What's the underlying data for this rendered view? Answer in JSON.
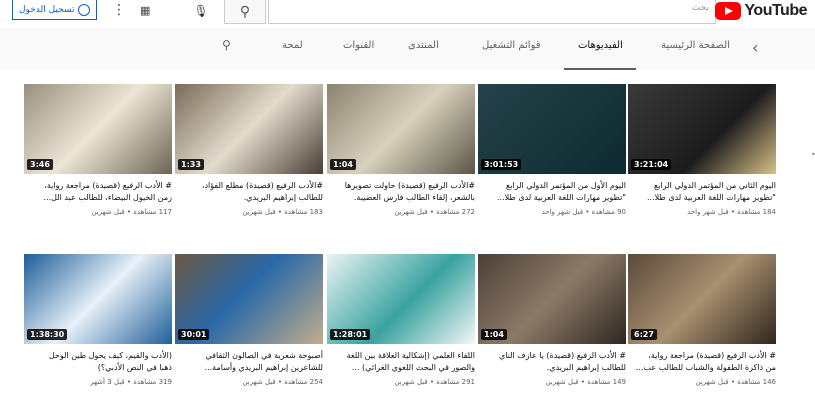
{
  "header": {
    "logo_text": "YouTube",
    "search_placeholder": "بحث",
    "signin_label": "تسجيل الدخول"
  },
  "tabs": {
    "items": [
      {
        "label": "الصفحة الرئيسية"
      },
      {
        "label": "الفيديوهات"
      },
      {
        "label": "قوائم التشغيل"
      },
      {
        "label": "المنتدى"
      },
      {
        "label": "القنوات"
      },
      {
        "label": "لمحة"
      }
    ],
    "active_index": 1
  },
  "videos": [
    {
      "title_line1": "اليوم الثاني من المؤتمر الدولي الرابع",
      "title_line2": "\"تطوير مهارات اللغة العربية لدى طلا...",
      "meta": "184 مشاهدة • قبل شهر واحد",
      "duration": "3:21:04",
      "thumb": "t1"
    },
    {
      "title_line1": "اليوم الأول من المؤتمر الدولي الرابع",
      "title_line2": "\"تطوير مهارات اللغة العربية لدى طلا...",
      "meta": "90 مشاهدة • قبل شهر واحد",
      "duration": "3:01:53",
      "thumb": "t2"
    },
    {
      "title_line1": "#الأدب الرفيع (قصيدة) حاولت تصويرها",
      "title_line2": "بالشعر، إلقاء الطالب فارس العضيبة.",
      "meta": "272 مشاهدة • قبل شهرين",
      "duration": "1:04",
      "thumb": "t3"
    },
    {
      "title_line1": "#الأدب الرفيع (قصيدة) مطلع الفؤاد،",
      "title_line2": "للطالب إبراهيم البريدي.",
      "meta": "183 مشاهدة • قبل شهرين",
      "duration": "1:33",
      "thumb": "t4"
    },
    {
      "title_line1": "# الأدب الرفيع (قصيدة) مراجعة رواية،",
      "title_line2": "زمن الخيول البيضاء، للطالب عبد الل...",
      "meta": "117 مشاهدة • قبل شهرين",
      "duration": "3:46",
      "thumb": "t5"
    },
    {
      "title_line1": "# الأدب الرفيع (قصيدة) مراجعة رواية،",
      "title_line2": "من ذاكرة الطفولة والشباب للطالب عب...",
      "meta": "146 مشاهدة • قبل شهرين",
      "duration": "6:27",
      "thumb": "t6"
    },
    {
      "title_line1": "# الأدب الرفيع (قصيدة) يا عازف الناي",
      "title_line2": "للطالب إبراهيم البريدي.",
      "meta": "149 مشاهدة • قبل شهرين",
      "duration": "1:04",
      "thumb": "t7"
    },
    {
      "title_line1": "اللقاء العلمي (إشكالية العلاقة بين اللغة",
      "title_line2": "والصور في البحث اللغوي الغرائي) ...",
      "meta": "291 مشاهدة • قبل شهرين",
      "duration": "1:28:01",
      "thumb": "t8"
    },
    {
      "title_line1": "أصبوحة شعرية في الصالون الثقافي",
      "title_line2": "للشاعرين إبراهيم البريدي وأسامة...",
      "meta": "254 مشاهدة • قبل شهرين",
      "duration": "30:01",
      "thumb": "t9"
    },
    {
      "title_line1": "(الأدب والقيم، كيف يحول طين الوحل",
      "title_line2": "ذهبا في النص الأدبي؟)",
      "meta": "319 مشاهدة • قبل 3 أشهر",
      "duration": "1:38:30",
      "thumb": "t10"
    }
  ]
}
